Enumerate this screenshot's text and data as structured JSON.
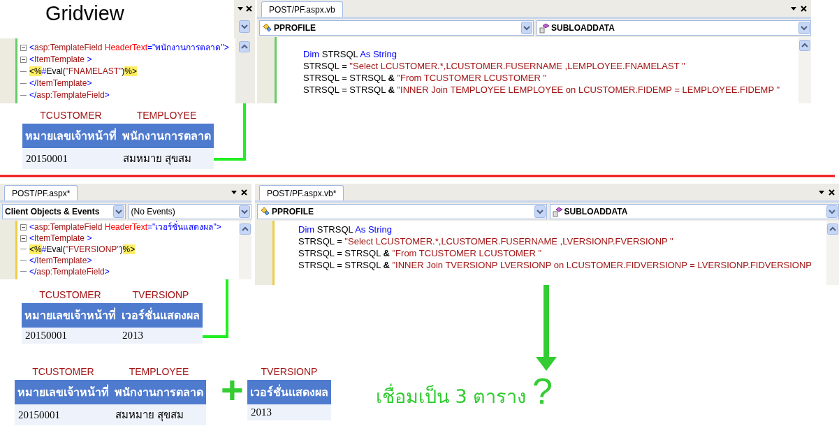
{
  "title": "Gridview",
  "top": {
    "markup_editor": {
      "lines": [
        {
          "fold": true,
          "tokens": [
            {
              "kind": "delim",
              "text": "<"
            },
            {
              "kind": "element",
              "text": "asp:TemplateField"
            },
            {
              "kind": "attr",
              "text": " HeaderText"
            },
            {
              "kind": "delim",
              "text": "=\"พนักงานการตลาด\">"
            }
          ]
        },
        {
          "fold": true,
          "tokens": [
            {
              "kind": "delim",
              "text": "<"
            },
            {
              "kind": "element",
              "text": "ItemTemplate"
            },
            {
              "kind": "delim",
              "text": " >"
            }
          ]
        },
        {
          "fold": false,
          "tokens": [
            {
              "kind": "hl",
              "text": "<%"
            },
            {
              "kind": "delim",
              "text": "#"
            },
            {
              "kind": "plain",
              "text": "Eval("
            },
            {
              "kind": "element",
              "text": "\"FNAMELAST\""
            },
            {
              "kind": "plain",
              "text": ")"
            },
            {
              "kind": "hl",
              "text": "%>"
            }
          ]
        },
        {
          "fold": false,
          "tokens": [
            {
              "kind": "delim",
              "text": "</"
            },
            {
              "kind": "element",
              "text": "ItemTemplate"
            },
            {
              "kind": "delim",
              "text": ">"
            }
          ]
        },
        {
          "fold": false,
          "tokens": [
            {
              "kind": "delim",
              "text": "</"
            },
            {
              "kind": "element",
              "text": "asp:TemplateField"
            },
            {
              "kind": "delim",
              "text": ">"
            }
          ]
        }
      ]
    },
    "code_editor": {
      "tab": "POST/PF.aspx.vb",
      "dropdowns": [
        {
          "kind": "class",
          "text": "PPROFILE"
        },
        {
          "kind": "method",
          "text": "SUBLOADDATA"
        }
      ],
      "lines": [
        {
          "tokens": [
            {
              "kind": "keyword",
              "text": "Dim"
            },
            {
              "kind": "plain",
              "text": " STRSQL "
            },
            {
              "kind": "keyword",
              "text": "As String"
            }
          ]
        },
        {
          "tokens": [
            {
              "kind": "plain",
              "text": "STRSQL = "
            },
            {
              "kind": "string",
              "text": "\"Select LCUSTOMER.*,LCUSTOMER.FUSERNAME ,LEMPLOYEE.FNAMELAST \""
            }
          ]
        },
        {
          "tokens": [
            {
              "kind": "plain",
              "text": "STRSQL = STRSQL "
            },
            {
              "kind": "op",
              "text": "&"
            },
            {
              "kind": "string",
              "text": " \"From TCUSTOMER LCUSTOMER \""
            }
          ]
        },
        {
          "tokens": [
            {
              "kind": "plain",
              "text": "STRSQL = STRSQL "
            },
            {
              "kind": "op",
              "text": "&"
            },
            {
              "kind": "string",
              "text": " \"INNER Join TEMPLOYEE LEMPLOYEE on LCUSTOMER.FIDEMP = LEMPLOYEE.FIDEMP \""
            }
          ]
        }
      ]
    },
    "grid": {
      "table_names": [
        "TCUSTOMER",
        "TEMPLOYEE"
      ],
      "columns": [
        "หมายเลขเจ้าหน้าที่",
        "พนักงานการตลาด"
      ],
      "rows": [
        [
          "20150001",
          "สมหมาย สุขสม"
        ]
      ]
    }
  },
  "bottom": {
    "markup_editor": {
      "tab": "POST/PF.aspx*",
      "dropdowns": [
        {
          "kind": "bold",
          "text": "Client Objects & Events"
        },
        {
          "kind": "plain",
          "text": "(No Events)"
        }
      ],
      "lines": [
        {
          "fold": true,
          "tokens": [
            {
              "kind": "delim",
              "text": "<"
            },
            {
              "kind": "element",
              "text": "asp:TemplateField"
            },
            {
              "kind": "attr",
              "text": " HeaderText"
            },
            {
              "kind": "delim",
              "text": "=\"เวอร์ชั่นแสดงผล\">"
            }
          ]
        },
        {
          "fold": true,
          "tokens": [
            {
              "kind": "delim",
              "text": "<"
            },
            {
              "kind": "element",
              "text": "ItemTemplate"
            },
            {
              "kind": "delim",
              "text": " >"
            }
          ]
        },
        {
          "fold": false,
          "tokens": [
            {
              "kind": "hl",
              "text": "<%"
            },
            {
              "kind": "delim",
              "text": "#"
            },
            {
              "kind": "plain",
              "text": "Eval("
            },
            {
              "kind": "element",
              "text": "\"FVERSIONP\""
            },
            {
              "kind": "plain",
              "text": ")"
            },
            {
              "kind": "hl",
              "text": "%>"
            }
          ]
        },
        {
          "fold": false,
          "tokens": [
            {
              "kind": "delim",
              "text": "</"
            },
            {
              "kind": "element",
              "text": "ItemTemplate"
            },
            {
              "kind": "delim",
              "text": ">"
            }
          ]
        },
        {
          "fold": false,
          "tokens": [
            {
              "kind": "delim",
              "text": "</"
            },
            {
              "kind": "element",
              "text": "asp:TemplateField"
            },
            {
              "kind": "delim",
              "text": ">"
            }
          ]
        }
      ]
    },
    "code_editor": {
      "tab": "POST/PF.aspx.vb*",
      "dropdowns": [
        {
          "kind": "class",
          "text": "PPROFILE"
        },
        {
          "kind": "method",
          "text": "SUBLOADDATA"
        }
      ],
      "lines": [
        {
          "tokens": [
            {
              "kind": "keyword",
              "text": "Dim"
            },
            {
              "kind": "plain",
              "text": " STRSQL "
            },
            {
              "kind": "keyword",
              "text": "As String"
            }
          ]
        },
        {
          "tokens": [
            {
              "kind": "plain",
              "text": "STRSQL = "
            },
            {
              "kind": "string",
              "text": "\"Select LCUSTOMER.*,LCUSTOMER.FUSERNAME ,LVERSIONP.FVERSIONP \""
            }
          ]
        },
        {
          "tokens": [
            {
              "kind": "plain",
              "text": "STRSQL = STRSQL "
            },
            {
              "kind": "op",
              "text": "&"
            },
            {
              "kind": "string",
              "text": " \"From TCUSTOMER LCUSTOMER \""
            }
          ]
        },
        {
          "tokens": [
            {
              "kind": "plain",
              "text": "STRSQL = STRSQL "
            },
            {
              "kind": "op",
              "text": "&"
            },
            {
              "kind": "string",
              "text": " \"INNER Join TVERSIONP LVERSIONP on LCUSTOMER.FIDVERSIONP = LVERSIONP.FIDVERSIONP"
            }
          ]
        }
      ]
    },
    "grid": {
      "table_names": [
        "TCUSTOMER",
        "TVERSIONP"
      ],
      "columns": [
        "หมายเลขเจ้าหน้าที่",
        "เวอร์ชั่นแสดงผล"
      ],
      "rows": [
        [
          "20150001",
          "2013"
        ]
      ]
    }
  },
  "result": {
    "grids": [
      {
        "table_names": [
          "TCUSTOMER",
          "TEMPLOYEE"
        ],
        "columns": [
          "หมายเลขเจ้าหน้าที่",
          "พนักงานการตลาด"
        ],
        "rows": [
          [
            "20150001",
            "สมหมาย สุขสม"
          ]
        ]
      },
      {
        "table_names": [
          "TVERSIONP"
        ],
        "columns": [
          "เวอร์ชั่นแสดงผล"
        ],
        "rows": [
          [
            "2013"
          ]
        ]
      }
    ],
    "operator": "+",
    "caption": "เชื่อมเป็น 3 ตาราง",
    "question_mark": "?"
  }
}
